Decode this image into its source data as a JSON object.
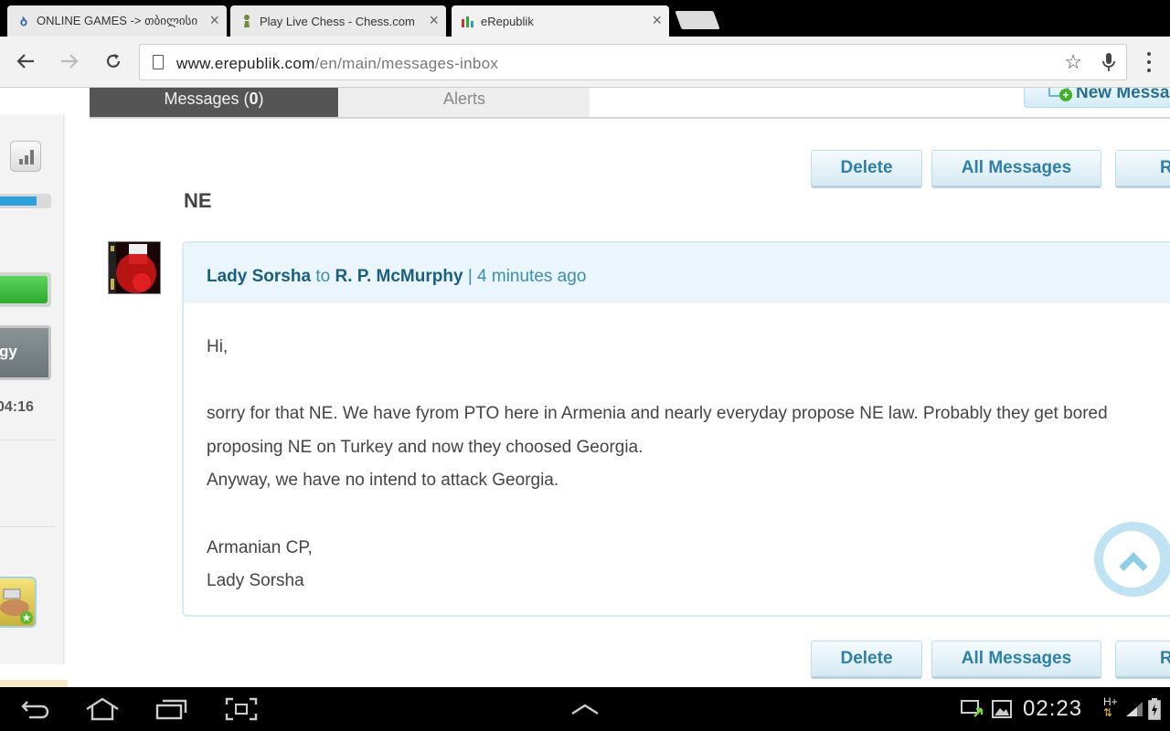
{
  "browser": {
    "tabs": [
      {
        "title": "ONLINE GAMES -> თბილისი",
        "favicon": "b"
      },
      {
        "title": "Play Live Chess - Chess.com",
        "favicon": "pawn"
      },
      {
        "title": "eRepublik",
        "favicon": "erep"
      }
    ],
    "url_host": "www.erepublik.com",
    "url_path": "/en/main/messages-inbox"
  },
  "sidebar": {
    "timer": "04:16",
    "button_label": "gy"
  },
  "inbox": {
    "tab_messages_label": "Messages",
    "tab_messages_count_open": " (",
    "tab_messages_count": "0",
    "tab_messages_count_close": ")",
    "tab_alerts_label": "Alerts",
    "new_message_label": "New Messa"
  },
  "actions": {
    "delete": "Delete",
    "all_messages": "All Messages",
    "reply_partial": "R"
  },
  "message": {
    "subject": "NE",
    "from": "Lady Sorsha",
    "to_word": "to",
    "to": "R. P. McMurphy",
    "separator": "|",
    "time": "4 minutes ago",
    "body": [
      "Hi,",
      "",
      "sorry for that NE. We have fyrom PTO here in Armenia and nearly everyday propose NE law. Probably they get bored proposing NE on Turkey and now they choosed Georgia.",
      "Anyway, we have no intend to attack Georgia.",
      "",
      "Armanian CP,",
      "Lady Sorsha"
    ]
  },
  "status_bar": {
    "clock": "02:23",
    "network": "H+"
  }
}
